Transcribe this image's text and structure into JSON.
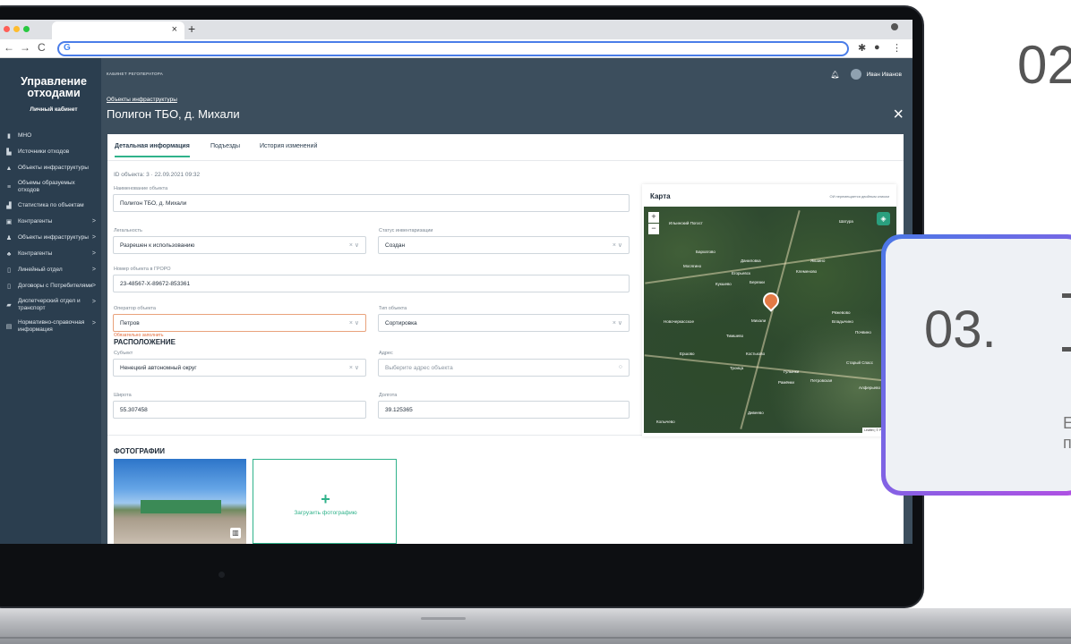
{
  "browser": {
    "tab_close": "×",
    "new_tab": "+",
    "nav_back": "←",
    "nav_forward": "→",
    "nav_reload": "C",
    "omnibox_logo": "G",
    "dot_colors": [
      "#ff5f57",
      "#febc2e",
      "#28c840"
    ]
  },
  "sidebar": {
    "brand_line1": "Управление",
    "brand_line2": "отходами",
    "brand_sub": "Личный кабинет",
    "items": [
      {
        "label": "МНО",
        "chevron": ""
      },
      {
        "label": "Источники отходов",
        "chevron": ""
      },
      {
        "label": "Объекты инфраструктуры",
        "chevron": ""
      },
      {
        "label": "Объемы образуемых отходов",
        "chevron": ""
      },
      {
        "label": "Статистика по объектам",
        "chevron": ""
      },
      {
        "label": "Контрагенты",
        "chevron": ">"
      },
      {
        "label": "Объекты инфраструктуры",
        "chevron": ">"
      },
      {
        "label": "Контрагенты",
        "chevron": ">"
      },
      {
        "label": "Линейный отдел",
        "chevron": ">"
      },
      {
        "label": "Договоры с Потребителями",
        "chevron": ">"
      },
      {
        "label": "Диспетчерский отдел и транспорт",
        "chevron": ">"
      },
      {
        "label": "Нормативно-справочная информация",
        "chevron": ">"
      }
    ]
  },
  "header": {
    "cabinet_label": "КАБИНЕТ РЕГОПЕРАТОРА",
    "user_name": "Иван Иванов",
    "breadcrumb": "Объекты инфраструктуры",
    "title": "Полигон ТБО, д. Михали",
    "close": "×"
  },
  "tabs": [
    {
      "label": "Детальная информация",
      "active": true
    },
    {
      "label": "Подъезды",
      "active": false
    },
    {
      "label": "История изменений",
      "active": false
    }
  ],
  "meta": "ID объекта: 3 · 22.09.2021 09:32",
  "form": {
    "name_label": "Наименование объекта",
    "name_value": "Полигон ТБО, д. Михали",
    "legality_label": "Легальность",
    "legality_value": "Разрешен к использованию",
    "inventory_label": "Статус инвентаризации",
    "inventory_value": "Создан",
    "grro_label": "Номер объекта в ГРОРО",
    "grro_value": "23-48567-X-89672-853361",
    "operator_label": "Оператор объекта",
    "operator_value": "Петров",
    "operator_error": "Обязательно заполнить",
    "type_label": "Тип объекта",
    "type_value": "Сортировка",
    "location_title": "РАСПОЛОЖЕНИЕ",
    "subject_label": "Субъект",
    "subject_value": "Ненецкий автономный округ",
    "address_label": "Адрес",
    "address_placeholder": "Выберите адрес объекта",
    "lat_label": "Широта",
    "lat_value": "55.307458",
    "lon_label": "Долгота",
    "lon_value": "39.125365",
    "select_controls": "× ∨"
  },
  "map": {
    "title": "Карта",
    "hint": "ОИ перемещается двойным кликом",
    "zoom_in": "+",
    "zoom_out": "−",
    "attribution": "Leaflet | © Росреестр",
    "places": [
      "Ильинский Погост",
      "Шатура",
      "Бархатово",
      "Даниловка",
      "Якшино",
      "Мосягино",
      "Егорьевск",
      "Клеменово",
      "Кукшево",
      "Березки",
      "Новочеркасское",
      "Михали",
      "Ряжевово",
      "Владычино",
      "Тимшево",
      "Почвино",
      "Ершово",
      "Костьково",
      "Троица",
      "Гулынки",
      "Рамёнки",
      "Петровская",
      "Старый Спасс",
      "Алферьево",
      "Дивеево",
      "Колычево"
    ]
  },
  "photos": {
    "title": "ФОТОГРАФИИ",
    "upload_plus": "+",
    "upload_label": "Загрузить фотографию"
  },
  "slides": {
    "num02": "02",
    "num03": "03.",
    "frag": "Е\nп"
  }
}
